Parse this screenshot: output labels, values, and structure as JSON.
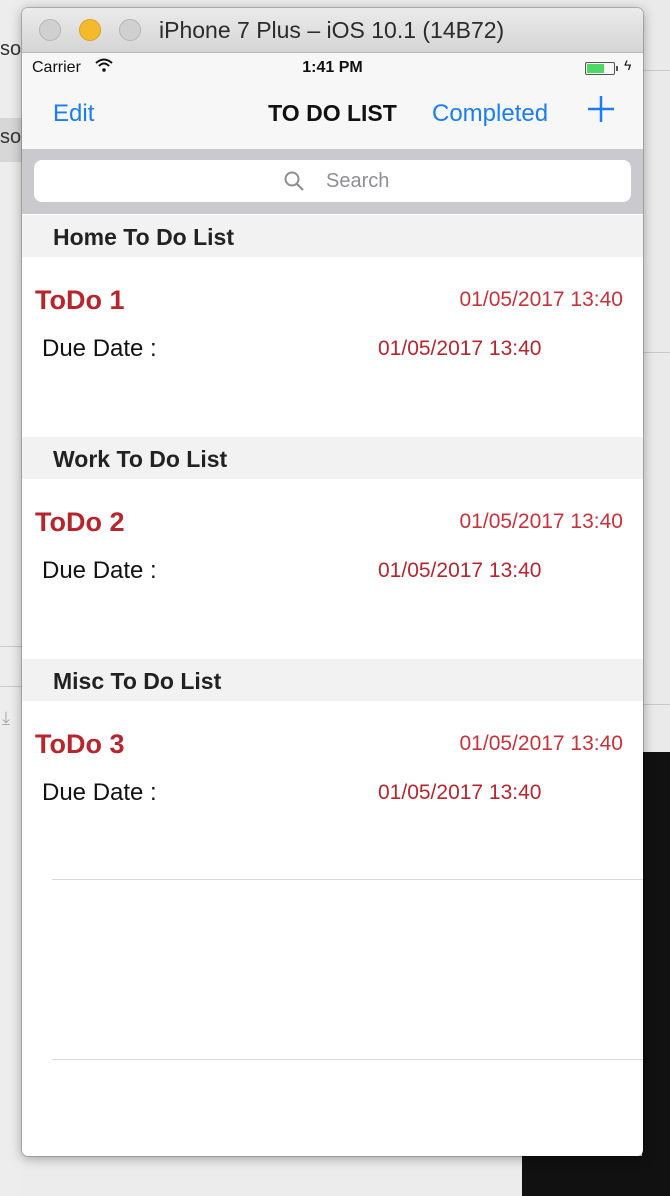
{
  "background": {
    "left_partial_text_1": "sor",
    "left_partial_text_2": "sor"
  },
  "window": {
    "title": "iPhone 7 Plus – iOS 10.1 (14B72)"
  },
  "status_bar": {
    "carrier": "Carrier",
    "time": "1:41 PM"
  },
  "nav": {
    "edit_label": "Edit",
    "title": "TO DO LIST",
    "completed_label": "Completed"
  },
  "search": {
    "placeholder": "Search"
  },
  "sections": [
    {
      "header": "Home To Do List",
      "item": {
        "title": "ToDo 1",
        "date": "01/05/2017 13:40",
        "due_label": "Due Date :",
        "due_value": "01/05/2017 13:40"
      }
    },
    {
      "header": "Work To Do List",
      "item": {
        "title": "ToDo 2",
        "date": "01/05/2017 13:40",
        "due_label": "Due Date :",
        "due_value": "01/05/2017 13:40"
      }
    },
    {
      "header": "Misc To Do List",
      "item": {
        "title": "ToDo 3",
        "date": "01/05/2017 13:40",
        "due_label": "Due Date :",
        "due_value": "01/05/2017 13:40"
      }
    }
  ],
  "colors": {
    "ios_blue": "#1b7df3",
    "todo_red": "#b5262d",
    "battery_green": "#4cd964"
  }
}
